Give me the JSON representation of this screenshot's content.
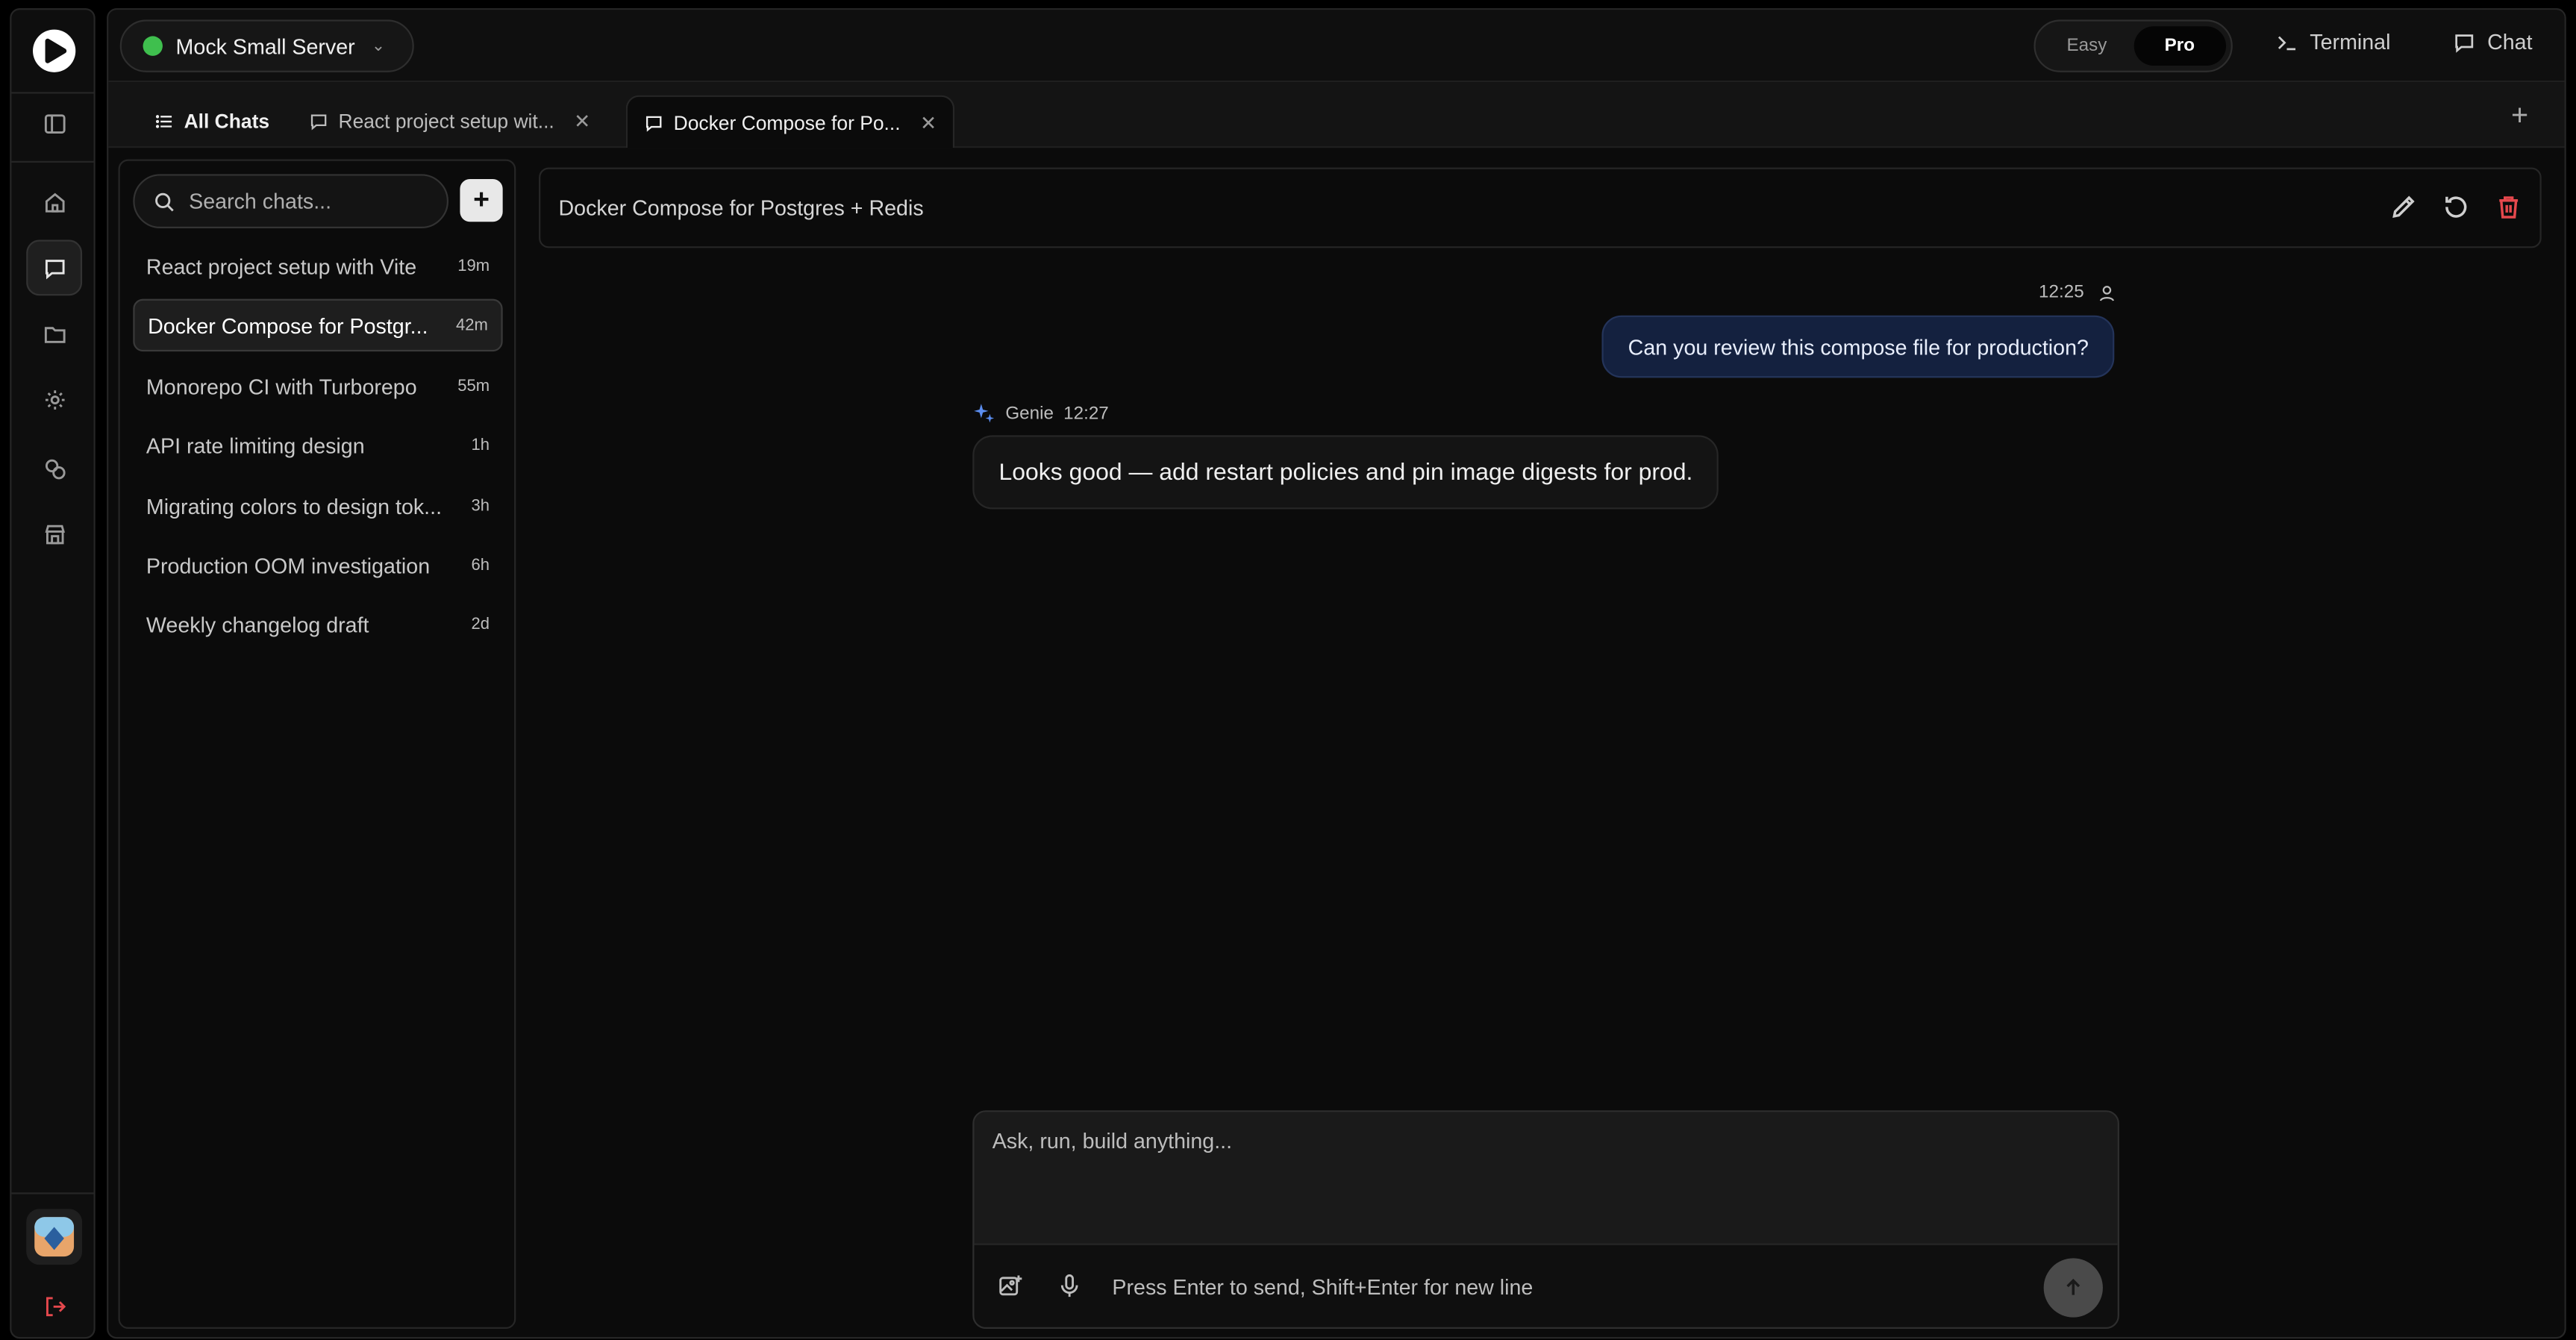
{
  "server": {
    "name": "Mock Small Server",
    "status_color": "#3fbf4e"
  },
  "mode": {
    "easy": "Easy",
    "pro": "Pro",
    "selected": "Pro"
  },
  "top_actions": {
    "terminal": "Terminal",
    "chat": "Chat"
  },
  "tabs": [
    {
      "label": "All Chats",
      "icon": "list-icon"
    },
    {
      "label": "React project setup wit...",
      "icon": "chat-bubble-icon"
    },
    {
      "label": "Docker Compose for Po...",
      "icon": "chat-bubble-icon",
      "active": true
    }
  ],
  "sidebar": {
    "search_placeholder": "Search chats...",
    "chats": [
      {
        "title": "React project setup with Vite",
        "age": "19m"
      },
      {
        "title": "Docker Compose for Postgr...",
        "age": "42m",
        "active": true
      },
      {
        "title": "Monorepo CI with Turborepo",
        "age": "55m"
      },
      {
        "title": "API rate limiting design",
        "age": "1h"
      },
      {
        "title": "Migrating colors to design tok...",
        "age": "3h"
      },
      {
        "title": "Production OOM investigation",
        "age": "6h"
      },
      {
        "title": "Weekly changelog draft",
        "age": "2d"
      }
    ]
  },
  "chat": {
    "title": "Docker Compose for Postgres + Redis",
    "messages": [
      {
        "role": "user",
        "time": "12:25",
        "text": "Can you review this compose file for production?"
      },
      {
        "role": "assistant",
        "name": "Genie",
        "time": "12:27",
        "text": "Looks good — add restart policies and pin image digests for prod."
      }
    ]
  },
  "composer": {
    "placeholder": "Ask, run, build anything...",
    "hint": "Press Enter to send, Shift+Enter for new line"
  },
  "colors": {
    "accent_user_bubble": "#14213f",
    "danger": "#e5484d",
    "genie": "#5b8def"
  }
}
